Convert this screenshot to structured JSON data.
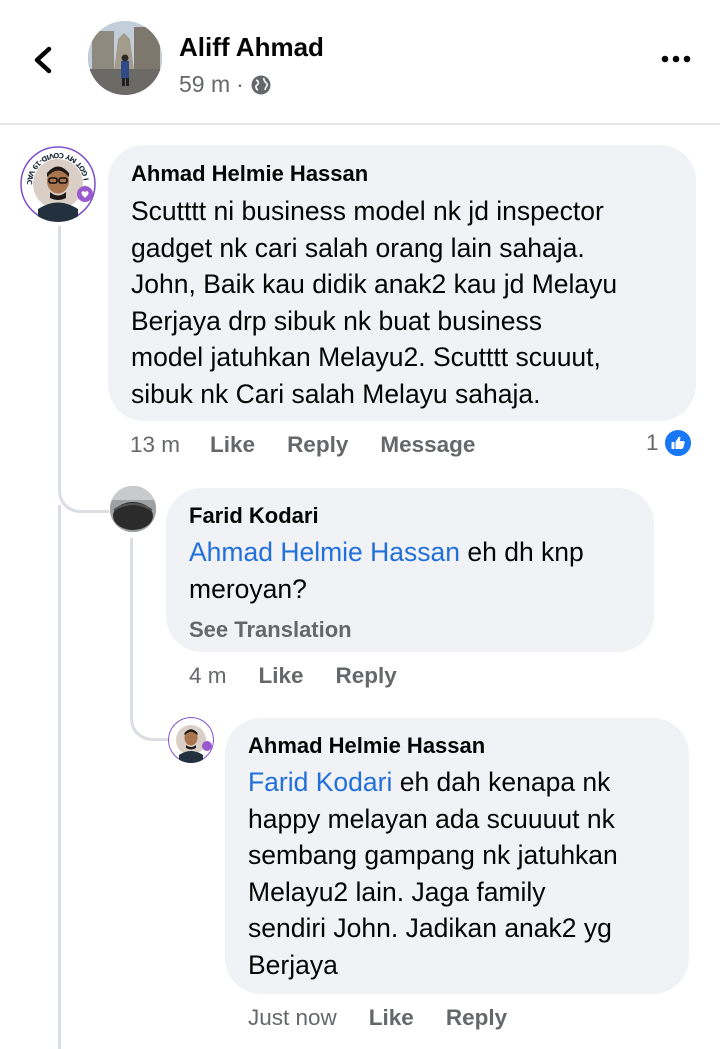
{
  "header": {
    "name": "Aliff Ahmad",
    "time": "59 m",
    "separator": "·"
  },
  "comments": [
    {
      "author": "Ahmad Helmie Hassan",
      "text": "Scutttt ni business model nk jd inspector gadget nk cari salah orang lain sahaja. John, Baik kau didik anak2 kau jd Melayu Berjaya drp sibuk nk buat business model jatuhkan Melayu2. Scutttt scuuut, sibuk nk Cari salah Melayu sahaja.",
      "lines": [
        "Scutttt ni business model nk jd inspector",
        "gadget nk cari salah orang lain sahaja.",
        "John, Baik kau didik anak2 kau jd Melayu",
        "Berjaya drp sibuk nk buat business",
        "model jatuhkan Melayu2. Scutttt scuuut,",
        "sibuk nk Cari salah Melayu sahaja."
      ],
      "time": "13 m",
      "actions": [
        "Like",
        "Reply",
        "Message"
      ],
      "reaction_count": "1",
      "avatar_text": "I GOT MY COVID-19 VACCINE"
    },
    {
      "author": "Farid Kodari",
      "mention": "Ahmad Helmie Hassan",
      "text_line1_rest": " eh dh knp",
      "text_line2": "meroyan?",
      "see_translation": "See Translation",
      "time": "4 m",
      "actions": [
        "Like",
        "Reply"
      ]
    },
    {
      "author": "Ahmad Helmie Hassan",
      "mention": "Farid Kodari",
      "text_line1_rest": " eh dah kenapa nk",
      "lines": [
        "happy melayan ada scuuuut nk",
        "sembang gampang nk jatuhkan",
        "Melayu2 lain. Jaga family",
        "sendiri John. Jadikan anak2 yg",
        "Berjaya"
      ],
      "time": "Just now",
      "actions": [
        "Like",
        "Reply"
      ]
    }
  ],
  "colors": {
    "mention": "#216fdb",
    "bubble": "#f0f2f5",
    "meta": "#65676b",
    "like_badge": "#1877f2"
  },
  "icons": [
    "back-arrow-icon",
    "globe-icon",
    "more-icon",
    "like-thumb-icon"
  ]
}
